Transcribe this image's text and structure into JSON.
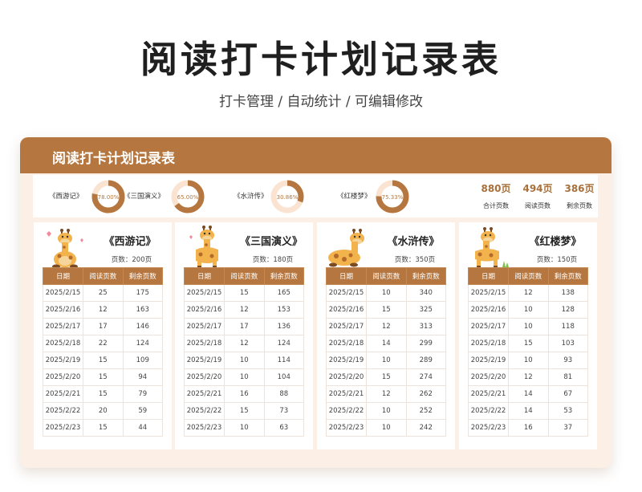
{
  "page": {
    "title": "阅读打卡计划记录表",
    "subtitle": "打卡管理 / 自动统计 /  可编辑修改"
  },
  "card": {
    "header_title": "阅读打卡计划记录表"
  },
  "colors": {
    "accent": "#b5773f",
    "ring_light": "#fbe3d2",
    "card_bg": "#fcefe6"
  },
  "summary": {
    "books": [
      {
        "name": "《西游记》",
        "percent_label": "78.00%",
        "percent": 0.78
      },
      {
        "name": "《三国演义》",
        "percent_label": "65.00%",
        "percent": 0.65
      },
      {
        "name": "《水浒传》",
        "percent_label": "30.86%",
        "percent": 0.3086
      },
      {
        "name": "《红楼梦》",
        "percent_label": "75.33%",
        "percent": 0.7533
      }
    ],
    "totals": [
      {
        "value": "880页",
        "label": "合计页数"
      },
      {
        "value": "494页",
        "label": "阅读页数"
      },
      {
        "value": "386页",
        "label": "剩余页数"
      }
    ]
  },
  "table_headers": [
    "日期",
    "阅读页数",
    "剩余页数"
  ],
  "panels": [
    {
      "title": "《西游记》",
      "pages_label": "页数：",
      "pages_value": "200页",
      "giraffe_icon": "giraffe-hearts-icon",
      "rows": [
        [
          "2025/2/15",
          "25",
          "175"
        ],
        [
          "2025/2/16",
          "12",
          "163"
        ],
        [
          "2025/2/17",
          "17",
          "146"
        ],
        [
          "2025/2/18",
          "22",
          "124"
        ],
        [
          "2025/2/19",
          "15",
          "109"
        ],
        [
          "2025/2/20",
          "15",
          "94"
        ],
        [
          "2025/2/21",
          "15",
          "79"
        ],
        [
          "2025/2/22",
          "20",
          "59"
        ],
        [
          "2025/2/23",
          "15",
          "44"
        ]
      ]
    },
    {
      "title": "《三国演义》",
      "pages_label": "页数：",
      "pages_value": "180页",
      "giraffe_icon": "giraffe-standing-icon",
      "rows": [
        [
          "2025/2/15",
          "15",
          "165"
        ],
        [
          "2025/2/16",
          "12",
          "153"
        ],
        [
          "2025/2/17",
          "17",
          "136"
        ],
        [
          "2025/2/18",
          "12",
          "124"
        ],
        [
          "2025/2/19",
          "10",
          "114"
        ],
        [
          "2025/2/20",
          "10",
          "104"
        ],
        [
          "2025/2/21",
          "16",
          "88"
        ],
        [
          "2025/2/22",
          "15",
          "73"
        ],
        [
          "2025/2/23",
          "10",
          "63"
        ]
      ]
    },
    {
      "title": "《水浒传》",
      "pages_label": "页数：",
      "pages_value": "350页",
      "giraffe_icon": "giraffe-lying-icon",
      "rows": [
        [
          "2025/2/15",
          "10",
          "340"
        ],
        [
          "2025/2/16",
          "15",
          "325"
        ],
        [
          "2025/2/17",
          "12",
          "313"
        ],
        [
          "2025/2/18",
          "14",
          "299"
        ],
        [
          "2025/2/19",
          "10",
          "289"
        ],
        [
          "2025/2/20",
          "15",
          "274"
        ],
        [
          "2025/2/21",
          "12",
          "262"
        ],
        [
          "2025/2/22",
          "10",
          "252"
        ],
        [
          "2025/2/23",
          "10",
          "242"
        ]
      ]
    },
    {
      "title": "《红楼梦》",
      "pages_label": "页数：",
      "pages_value": "150页",
      "giraffe_icon": "giraffe-grass-icon",
      "rows": [
        [
          "2025/2/15",
          "12",
          "138"
        ],
        [
          "2025/2/16",
          "10",
          "128"
        ],
        [
          "2025/2/17",
          "10",
          "118"
        ],
        [
          "2025/2/18",
          "15",
          "103"
        ],
        [
          "2025/2/19",
          "10",
          "93"
        ],
        [
          "2025/2/20",
          "12",
          "81"
        ],
        [
          "2025/2/21",
          "14",
          "67"
        ],
        [
          "2025/2/22",
          "14",
          "53"
        ],
        [
          "2025/2/23",
          "16",
          "37"
        ]
      ]
    }
  ]
}
